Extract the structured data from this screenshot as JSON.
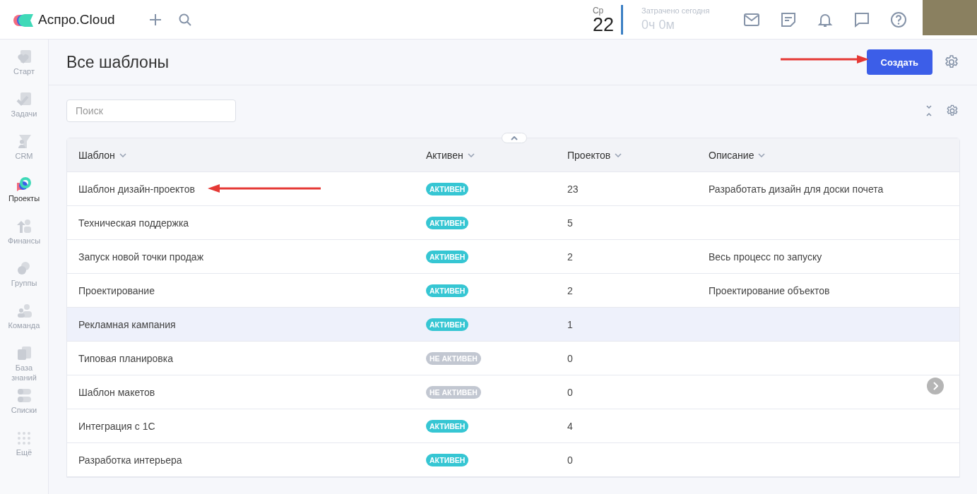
{
  "app": {
    "logo": "Аспро.Cloud"
  },
  "topbar": {
    "day_name": "Ср",
    "day": "22",
    "time_label": "Затрачено сегодня",
    "time_value": "0ч 0м"
  },
  "sidebar": {
    "items": [
      {
        "label": "Старт",
        "kind": "start",
        "selected": false
      },
      {
        "label": "Задачи",
        "kind": "tasks",
        "selected": false
      },
      {
        "label": "CRM",
        "kind": "crm",
        "selected": false
      },
      {
        "label": "Проекты",
        "kind": "projects",
        "selected": true
      },
      {
        "label": "Финансы",
        "kind": "finance",
        "selected": false
      },
      {
        "label": "Группы",
        "kind": "groups",
        "selected": false
      },
      {
        "label": "Команда",
        "kind": "team",
        "selected": false
      },
      {
        "label": "База знаний",
        "kind": "knowledge",
        "selected": false
      },
      {
        "label": "Списки",
        "kind": "lists",
        "selected": false
      },
      {
        "label": "Ещё",
        "kind": "more",
        "selected": false
      }
    ]
  },
  "page": {
    "title": "Все шаблоны",
    "create_button": "Создать"
  },
  "search": {
    "placeholder": "Поиск"
  },
  "table": {
    "columns": [
      "Шаблон",
      "Активен",
      "Проектов",
      "Описание"
    ],
    "rows": [
      {
        "template": "Шаблон дизайн-проектов",
        "status": "АКТИВЕН",
        "active": true,
        "projects": "23",
        "description": "Разработать дизайн для доски почета",
        "highlighted": false
      },
      {
        "template": "Техническая поддержка",
        "status": "АКТИВЕН",
        "active": true,
        "projects": "5",
        "highlighted": false
      },
      {
        "template": "Запуск новой точки продаж",
        "status": "АКТИВЕН",
        "active": true,
        "projects": "2",
        "description": "Весь процесс по запуску",
        "highlighted": false
      },
      {
        "template": "Проектирование",
        "status": "АКТИВЕН",
        "active": true,
        "projects": "2",
        "description": "Проектирование объектов",
        "highlighted": false
      },
      {
        "template": "Рекламная кампания",
        "status": "АКТИВЕН",
        "active": true,
        "projects": "1",
        "highlighted": true
      },
      {
        "template": "Типовая планировка",
        "status": "НЕ АКТИВЕН",
        "active": false,
        "projects": "0",
        "highlighted": false
      },
      {
        "template": "Шаблон макетов",
        "status": "НЕ АКТИВЕН",
        "active": false,
        "projects": "0",
        "highlighted": false
      },
      {
        "template": "Интеграция с 1С",
        "status": "АКТИВЕН",
        "active": true,
        "projects": "4",
        "highlighted": false
      },
      {
        "template": "Разработка интерьера",
        "status": "АКТИВЕН",
        "active": true,
        "projects": "0",
        "highlighted": false
      }
    ]
  }
}
